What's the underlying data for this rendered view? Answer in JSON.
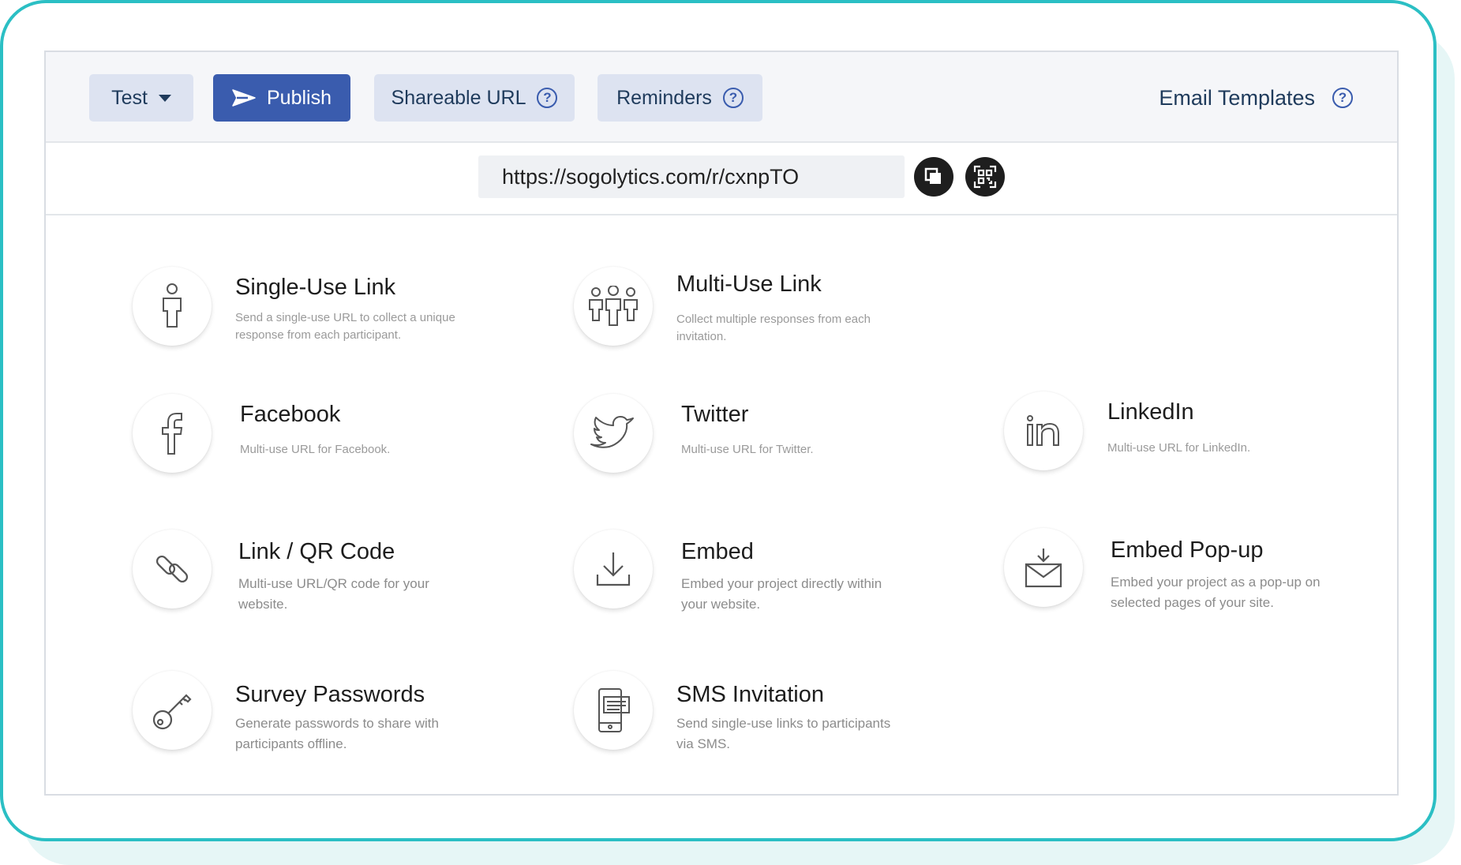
{
  "toolbar": {
    "test_label": "Test",
    "publish_label": "Publish",
    "shareable_url_label": "Shareable URL",
    "reminders_label": "Reminders",
    "email_templates_label": "Email Templates",
    "help_glyph": "?"
  },
  "url_bar": {
    "url": "https://sogolytics.com/r/cxnpTO",
    "copy_icon": "copy-icon",
    "qr_icon": "qr-code-icon"
  },
  "options": [
    {
      "title": "Single-Use Link",
      "description": "Send a single-use URL to collect a unique response from each participant.",
      "icon": "single-person-icon"
    },
    {
      "title": "Multi-Use Link",
      "description": "Collect multiple responses from each invitation.",
      "icon": "group-people-icon"
    },
    {
      "title": "Facebook",
      "description": "Multi-use URL for Facebook.",
      "icon": "facebook-icon"
    },
    {
      "title": "Twitter",
      "description": "Multi-use URL for Twitter.",
      "icon": "twitter-icon"
    },
    {
      "title": "LinkedIn",
      "description": "Multi-use URL for LinkedIn.",
      "icon": "linkedin-icon"
    },
    {
      "title": "Link / QR Code",
      "description": "Multi-use URL/QR code for your website.",
      "icon": "link-icon"
    },
    {
      "title": "Embed",
      "description": "Embed your project directly within your website.",
      "icon": "download-icon"
    },
    {
      "title": "Embed Pop-up",
      "description": "Embed your project as a pop-up on selected pages of your site.",
      "icon": "envelope-download-icon"
    },
    {
      "title": "Survey Passwords",
      "description": "Generate passwords to share with participants offline.",
      "icon": "key-icon"
    },
    {
      "title": "SMS Invitation",
      "description": "Send single-use links to participants via SMS.",
      "icon": "sms-phone-icon"
    }
  ],
  "colors": {
    "accent": "#3a5cae",
    "frame_border": "#2bbfc4",
    "button_bg": "#dde3f1"
  }
}
